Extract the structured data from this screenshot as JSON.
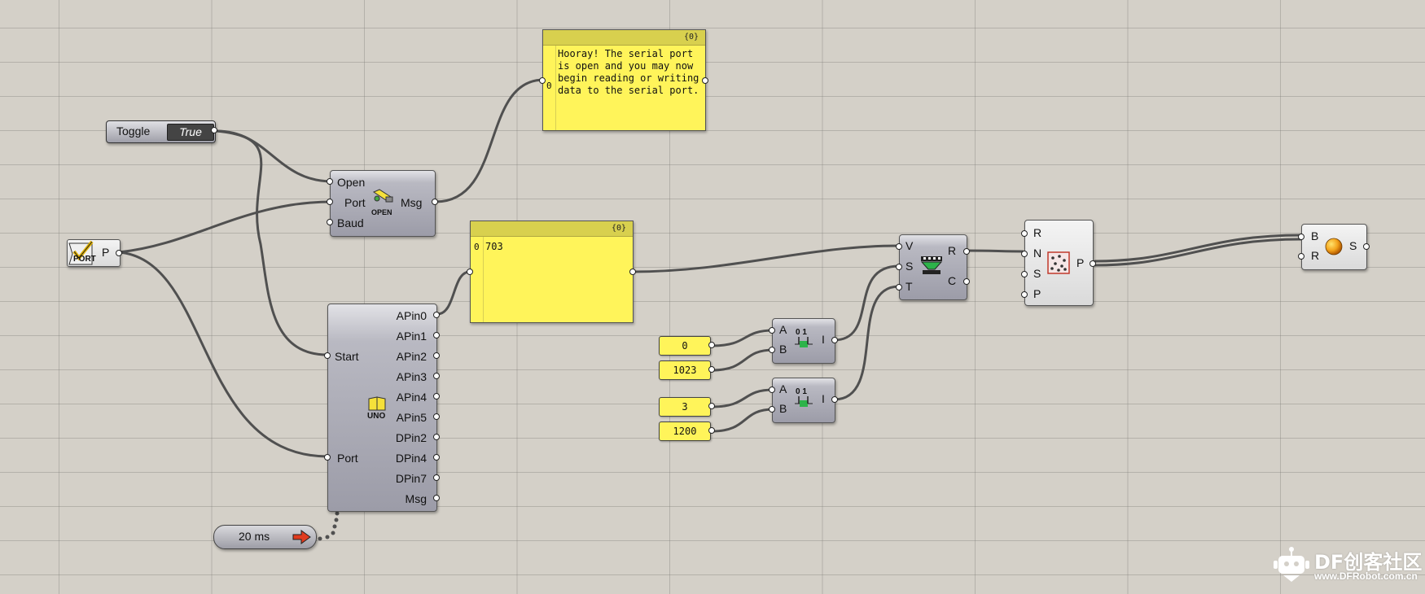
{
  "toggle": {
    "label": "Toggle",
    "value": "True"
  },
  "port_param": {
    "label": "P",
    "icon_text": "PORT"
  },
  "open_component": {
    "inputs": [
      "Open",
      "Port",
      "Baud"
    ],
    "output": "Msg",
    "icon_text": "OPEN"
  },
  "message_panel": {
    "header": "{0}",
    "index": "0",
    "text": "Hooray! The serial port is open and you may now begin reading or writing data to the serial port."
  },
  "uno_component": {
    "inputs": [
      "Start",
      "Port"
    ],
    "outputs": [
      "APin0",
      "APin1",
      "APin2",
      "APin3",
      "APin4",
      "APin5",
      "DPin2",
      "DPin4",
      "DPin7",
      "Msg"
    ],
    "icon_text": "UNO"
  },
  "value_panel": {
    "header": "{0}",
    "index": "0",
    "text": "703"
  },
  "timer": {
    "label": "20 ms"
  },
  "numbers": [
    "0",
    "1023",
    "3",
    "1200"
  ],
  "construct_domain_1": {
    "inputs": [
      "A",
      "B"
    ],
    "output": "I",
    "icon_text": "0 1"
  },
  "construct_domain_2": {
    "inputs": [
      "A",
      "B"
    ],
    "output": "I",
    "icon_text": "0 1"
  },
  "remap": {
    "inputs": [
      "V",
      "S",
      "T"
    ],
    "outputs": [
      "R",
      "C"
    ]
  },
  "populate": {
    "inputs": [
      "R",
      "N",
      "S",
      "P"
    ],
    "output": "P"
  },
  "solid_component": {
    "inputs": [
      "B",
      "R"
    ],
    "output": "S"
  },
  "watermark": {
    "brand": "DF创客社区",
    "url": "www.DFRobot.com.cn"
  },
  "colors": {
    "canvas": "#d4d0c8",
    "panel": "#fff45a",
    "panel_header": "#d8d04e",
    "wire": "#505050",
    "node": "#a5a5b0"
  }
}
